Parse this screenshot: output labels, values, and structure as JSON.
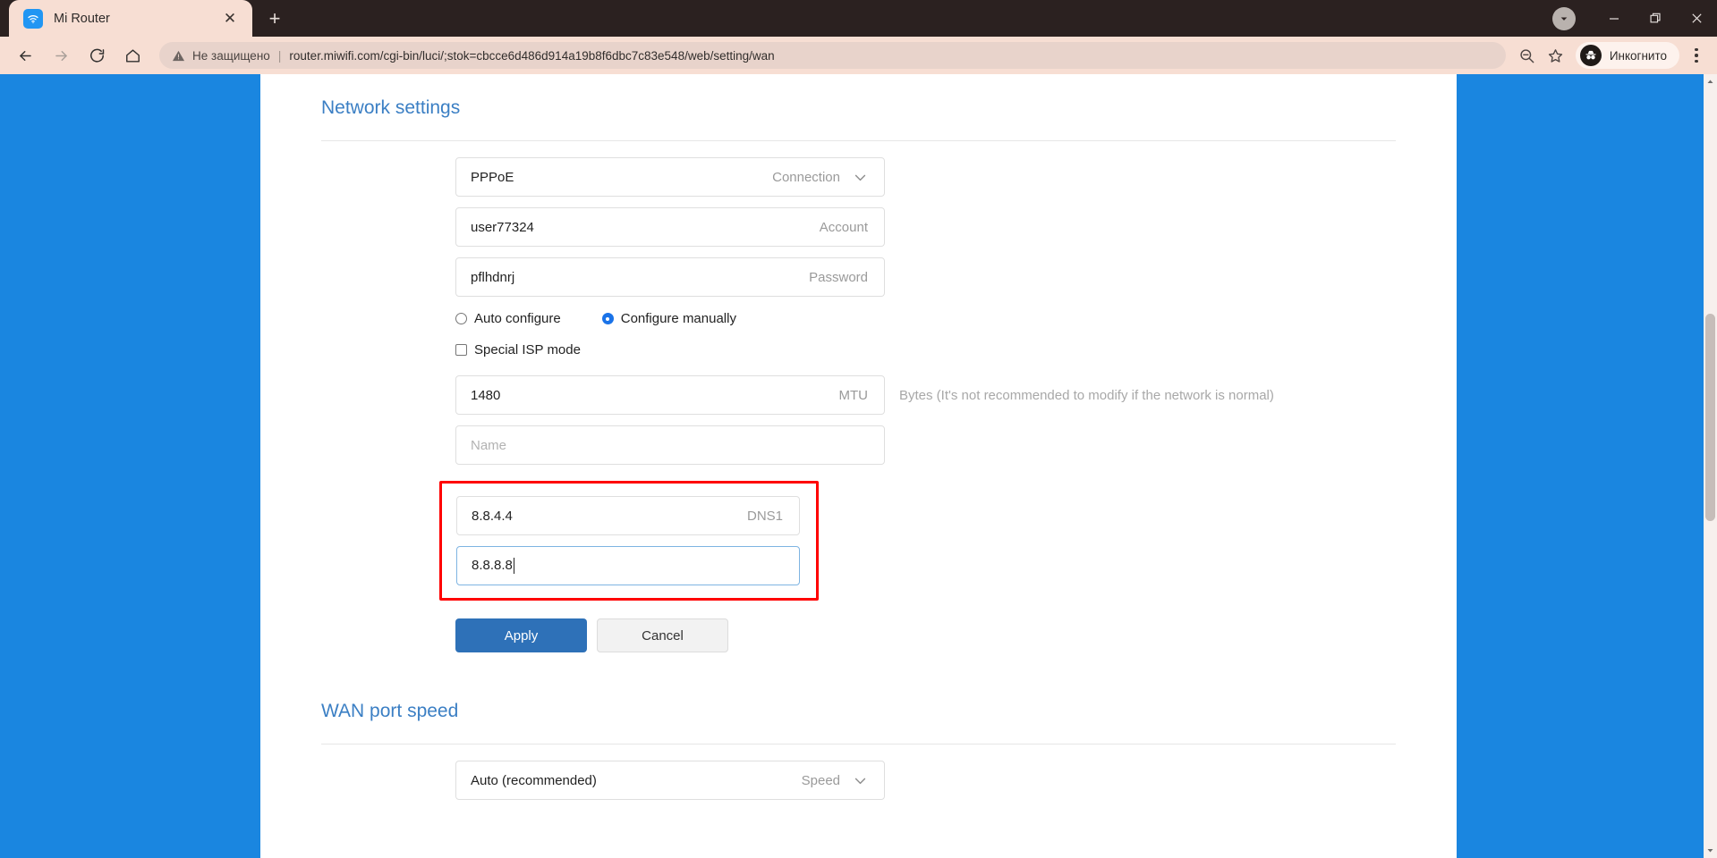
{
  "browser": {
    "tab": {
      "title": "Mi Router",
      "favicon": "wifi-icon",
      "close": "✕"
    },
    "new_tab_label": "+",
    "window_controls": {
      "minimize": "—",
      "maximize": "restore-icon",
      "close": "✕",
      "extra": "chevron-down-circle"
    },
    "nav": {
      "back": "←",
      "forward": "→",
      "reload": "⟳",
      "home": "home-icon"
    },
    "omnibox": {
      "security_text": "Не защищено",
      "separator": "|",
      "url": "router.miwifi.com/cgi-bin/luci/;stok=cbcce6d486d914a19b8f6dbc7c83e548/web/setting/wan",
      "zoom_icon": "zoom-out-icon",
      "bookmark_icon": "star-icon"
    },
    "profile": {
      "label": "Инкогнито",
      "icon": "incognito-icon"
    },
    "menu": "three-dot-menu"
  },
  "page": {
    "network_settings": {
      "title": "Network settings",
      "fields": [
        {
          "name": "connection",
          "value": "PPPoE",
          "label": "Connection",
          "dropdown": true,
          "placeholder": ""
        },
        {
          "name": "account",
          "value": "user77324",
          "label": "Account",
          "dropdown": false,
          "placeholder": ""
        },
        {
          "name": "password",
          "value": "pflhdnrj",
          "label": "Password",
          "dropdown": false,
          "placeholder": ""
        }
      ],
      "radios": [
        {
          "name": "auto-configure",
          "label": "Auto configure",
          "selected": false
        },
        {
          "name": "configure-manually",
          "label": "Configure manually",
          "selected": true
        }
      ],
      "checkbox": {
        "name": "special-isp-mode",
        "label": "Special ISP mode",
        "checked": false
      },
      "mtu": {
        "value": "1480",
        "label": "MTU",
        "hint": "Bytes (It's not recommended to modify if the network is normal)"
      },
      "service_name": {
        "value": "",
        "placeholder": "Name",
        "label": ""
      },
      "dns1": {
        "value": "8.8.4.4",
        "label": "DNS1"
      },
      "dns2": {
        "value": "8.8.8.8",
        "label": "",
        "focused": true
      },
      "apply_label": "Apply",
      "cancel_label": "Cancel",
      "highlight_color": "#ff0000"
    },
    "wan_port_speed": {
      "title": "WAN port speed",
      "field": {
        "value": "Auto (recommended)",
        "label": "Speed",
        "dropdown": true
      }
    }
  },
  "colors": {
    "accent_blue": "#3b7fc4",
    "page_background": "#1a86e0",
    "primary_button": "#2e71b8",
    "radio_selected": "#1a73e8"
  }
}
